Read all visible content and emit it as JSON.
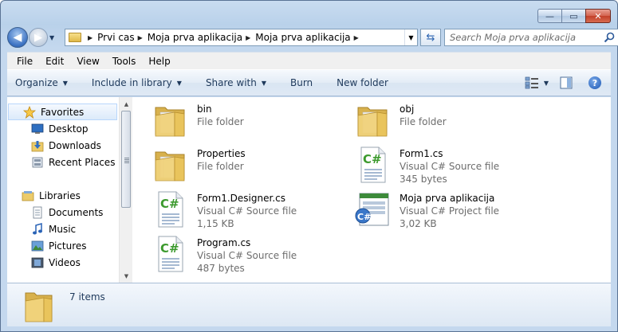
{
  "window": {
    "caption": {
      "minimize": "—",
      "maximize": "▭",
      "close": "✕"
    }
  },
  "nav": {
    "breadcrumb": [
      "Prvi cas",
      "Moja prva aplikacija",
      "Moja prva aplikacija"
    ],
    "search_placeholder": "Search Moja prva aplikacija"
  },
  "menubar": [
    "File",
    "Edit",
    "View",
    "Tools",
    "Help"
  ],
  "cmdbar": {
    "organize": "Organize",
    "include": "Include in library",
    "share": "Share with",
    "burn": "Burn",
    "newfolder": "New folder",
    "help": "?"
  },
  "sidebar": {
    "favorites": {
      "label": "Favorites",
      "items": [
        "Desktop",
        "Downloads",
        "Recent Places"
      ]
    },
    "libraries": {
      "label": "Libraries",
      "items": [
        "Documents",
        "Music",
        "Pictures",
        "Videos"
      ]
    }
  },
  "files": [
    {
      "name": "bin",
      "meta1": "File folder",
      "meta2": "",
      "icon": "folder-icon"
    },
    {
      "name": "obj",
      "meta1": "File folder",
      "meta2": "",
      "icon": "folder-icon"
    },
    {
      "name": "Properties",
      "meta1": "File folder",
      "meta2": "",
      "icon": "folder-icon"
    },
    {
      "name": "Form1.cs",
      "meta1": "Visual C# Source file",
      "meta2": "345 bytes",
      "icon": "csharp-file-icon"
    },
    {
      "name": "Form1.Designer.cs",
      "meta1": "Visual C# Source file",
      "meta2": "1,15 KB",
      "icon": "csharp-file-icon"
    },
    {
      "name": "Moja prva aplikacija",
      "meta1": "Visual C# Project file",
      "meta2": "3,02 KB",
      "icon": "csharp-project-icon"
    },
    {
      "name": "Program.cs",
      "meta1": "Visual C# Source file",
      "meta2": "487 bytes",
      "icon": "csharp-file-icon"
    }
  ],
  "details": {
    "count": "7 items"
  }
}
